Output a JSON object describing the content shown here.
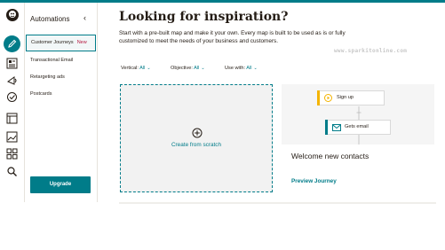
{
  "app": {
    "accent_color": "#007c89",
    "logo_icon": "freddie-logo-icon"
  },
  "rail": {
    "items": [
      {
        "name": "create-icon",
        "active": true
      },
      {
        "name": "audience-icon"
      },
      {
        "name": "campaigns-icon"
      },
      {
        "name": "automations-icon"
      },
      {
        "name": "website-icon"
      },
      {
        "name": "content-icon"
      },
      {
        "name": "integrations-icon"
      },
      {
        "name": "search-icon"
      }
    ]
  },
  "subnav": {
    "title": "Automations",
    "collapse_icon": "chevron-left-icon",
    "items": [
      {
        "label": "Customer Journeys",
        "badge": "New",
        "active": true
      },
      {
        "label": "Transactional Email"
      },
      {
        "label": "Retargeting ads"
      },
      {
        "label": "Postcards"
      }
    ],
    "upgrade_label": "Upgrade"
  },
  "main": {
    "title": "Looking for inspiration?",
    "description": "Start with a pre-built map and make it your own. Every map is built to be used as is or fully customized to meet the needs of your business and customers.",
    "watermark": "www.sparkitonline.com",
    "filters": [
      {
        "label": "Vertical:",
        "value": "All"
      },
      {
        "label": "Objective:",
        "value": "All"
      },
      {
        "label": "Use with:",
        "value": "All"
      }
    ],
    "scratch_card": {
      "label": "Create from scratch",
      "icon": "plus-circle-icon"
    },
    "template_card": {
      "nodes": [
        {
          "label": "Sign up",
          "icon": "play-icon",
          "color": "#f4b400"
        },
        {
          "label": "Gets email",
          "icon": "envelope-icon",
          "color": "#007c89"
        }
      ],
      "title": "Welcome new contacts",
      "link": "Preview Journey"
    }
  }
}
